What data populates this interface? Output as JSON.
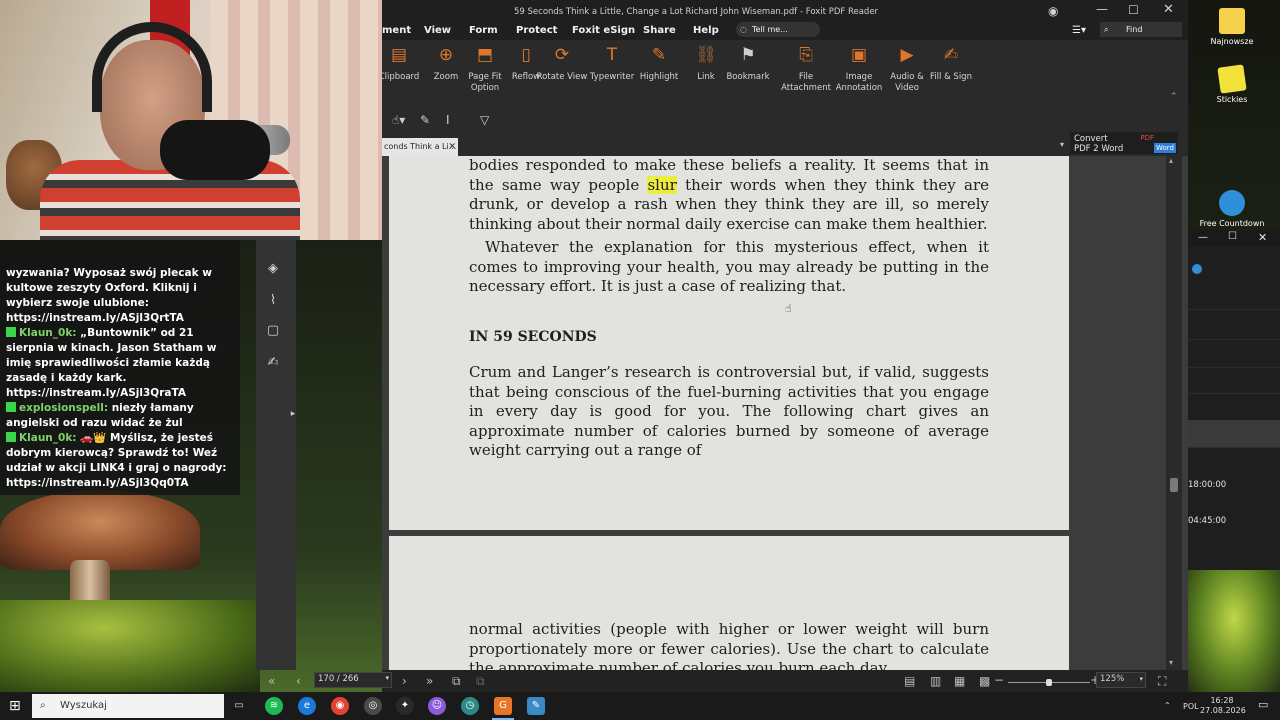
{
  "window": {
    "title": "59 Seconds Think a Little, Change a Lot Richard John Wiseman.pdf - Foxit PDF Reader",
    "tell_me": "Tell me...",
    "find": "Find"
  },
  "menu": [
    "ment",
    "View",
    "Form",
    "Protect",
    "Foxit eSign",
    "Share",
    "Help"
  ],
  "ribbon": [
    {
      "label": "Clipboard",
      "icon": "clipboard-icon",
      "glyph": "▤"
    },
    {
      "label": "Zoom",
      "icon": "zoom-icon",
      "glyph": "⊕"
    },
    {
      "label": "Page Fit Option",
      "icon": "page-fit-icon",
      "glyph": "⬒"
    },
    {
      "label": "Reflow",
      "icon": "reflow-icon",
      "glyph": "▯"
    },
    {
      "label": "Rotate View",
      "icon": "rotate-icon",
      "glyph": "⟳"
    },
    {
      "label": "Typewriter",
      "icon": "typewriter-icon",
      "glyph": "T"
    },
    {
      "label": "Highlight",
      "icon": "highlight-icon",
      "glyph": "✎"
    },
    {
      "label": "Link",
      "icon": "link-icon",
      "glyph": "⛓"
    },
    {
      "label": "Bookmark",
      "icon": "bookmark-icon",
      "glyph": "⚑"
    },
    {
      "label": "File Attachment",
      "icon": "file-attachment-icon",
      "glyph": "⎘"
    },
    {
      "label": "Image Annotation",
      "icon": "image-annotation-icon",
      "glyph": "▣"
    },
    {
      "label": "Audio & Video",
      "icon": "audio-video-icon",
      "glyph": "▶"
    },
    {
      "label": "Fill & Sign",
      "icon": "fill-sign-icon",
      "glyph": "✍"
    }
  ],
  "doc_tab": "conds Think a Li...",
  "convert": {
    "line1": "Convert",
    "line2": "PDF 2 Word",
    "badge_top": "PDF",
    "badge_bottom": "Word"
  },
  "page1": {
    "para1_a": "bodies responded to make these beliefs a reality. It seems that in the same way people ",
    "para1_hl": "slur",
    "para1_b": " their words when they think they are drunk, or develop a rash when they think they are ill, so merely thinking about their normal daily exercise can make them healthier.",
    "para2": "Whatever the explanation for this mysterious effect, when it comes to improving your health, you may already be putting in the necessary effort. It is just a case of realizing that.",
    "heading": "IN 59 SECONDS",
    "para3": "Crum and Langer’s research is controversial but, if valid, suggests that being conscious of the fuel-burning activities that you engage in every day is good for you. The following chart gives an approximate number of calories burned by someone of average weight carrying out a range of"
  },
  "page2": {
    "para1": "normal activities (people with higher or lower weight will burn proportionately more or fewer calories). Use the chart to calculate the approximate number of calories you burn each day."
  },
  "status": {
    "page_indicator": "170 / 266",
    "zoom": "125%"
  },
  "chat": [
    {
      "user": "",
      "text": "wyzwania? Wyposaż swój plecak w kultowe zeszyty Oxford. Kliknij i wybierz swoje ulubione: https://instream.ly/ASjl3QrtTA"
    },
    {
      "user": "Klaun_0k:",
      "text": " „Buntownik” od 21 sierpnia w kinach. Jason Statham w imię sprawiedliwości złamie każdą zasadę i każdy kark. https://instream.ly/ASjl3QraTA"
    },
    {
      "user": "explosionspell:",
      "text": "  niezły łamany angielski od razu widać że żul"
    },
    {
      "user": "Klaun_0k:",
      "text": " 🚗👑 Myślisz, że jesteś dobrym kierowcą? Sprawdź to! Weź udział w akcji LINK4 i graj o nagrody: https://instream.ly/ASjl3Qq0TA"
    }
  ],
  "desktop_icons": [
    {
      "label": "Najnowsze",
      "color": "#f5d24a"
    },
    {
      "label": "Stickies",
      "color": "#f2e23a"
    },
    {
      "label": "Free Countdown",
      "color": "#2f8fd8"
    }
  ],
  "right_window": {
    "time1": "18:00:00",
    "time2": "04:45:00"
  },
  "taskbar": {
    "search": "Wyszukaj",
    "lang": "POL",
    "time": "16:28",
    "date": "27.08.2026"
  }
}
